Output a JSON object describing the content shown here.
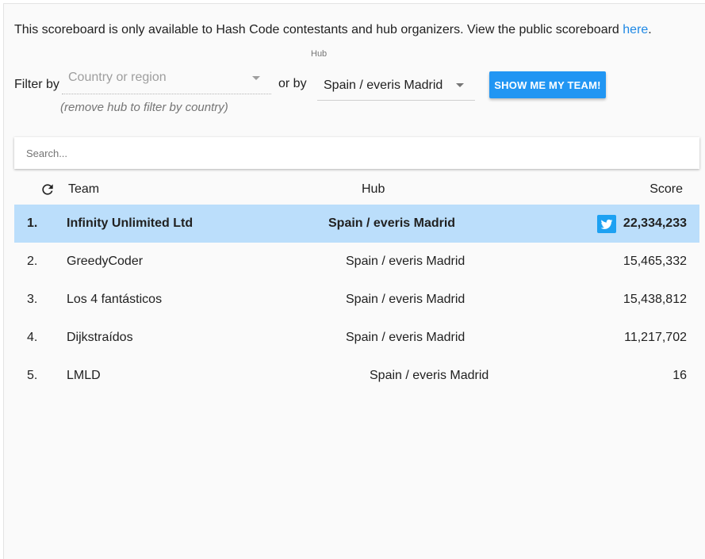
{
  "notice": {
    "text": "This scoreboard is only available to Hash Code contestants and hub organizers. View the public scoreboard ",
    "link_label": "here",
    "period": "."
  },
  "filters": {
    "filter_label": "Filter by",
    "country_placeholder": "Country or region",
    "country_hint": "(remove hub to filter by country)",
    "or_label": "or by",
    "hub_label": "Hub",
    "hub_value": "Spain / everis Madrid",
    "show_team_button": "SHOW ME MY TEAM!"
  },
  "search": {
    "placeholder": "Search..."
  },
  "table": {
    "columns": {
      "team": "Team",
      "hub": "Hub",
      "score": "Score"
    },
    "rows": [
      {
        "rank": "1.",
        "team": "Infinity Unlimited Ltd",
        "hub": "Spain / everis Madrid",
        "score": "22,334,233",
        "highlighted": true
      },
      {
        "rank": "2.",
        "team": "GreedyCoder",
        "hub": "Spain / everis Madrid",
        "score": "15,465,332"
      },
      {
        "rank": "3.",
        "team": "Los 4 fantásticos",
        "hub": "Spain / everis Madrid",
        "score": "15,438,812"
      },
      {
        "rank": "4.",
        "team": "Dijkstraídos",
        "hub": "Spain / everis Madrid",
        "score": "11,217,702"
      },
      {
        "rank": "5.",
        "team": "LMLD",
        "hub": "Spain / everis Madrid",
        "score": "16"
      }
    ]
  },
  "icons": {
    "refresh": "refresh-icon",
    "twitter": "twitter-icon",
    "dropdown": "chevron-down-icon"
  },
  "colors": {
    "accent": "#2196f3",
    "link": "#1e88e5",
    "highlight_row": "#bbdefb",
    "twitter": "#1da1f2"
  }
}
